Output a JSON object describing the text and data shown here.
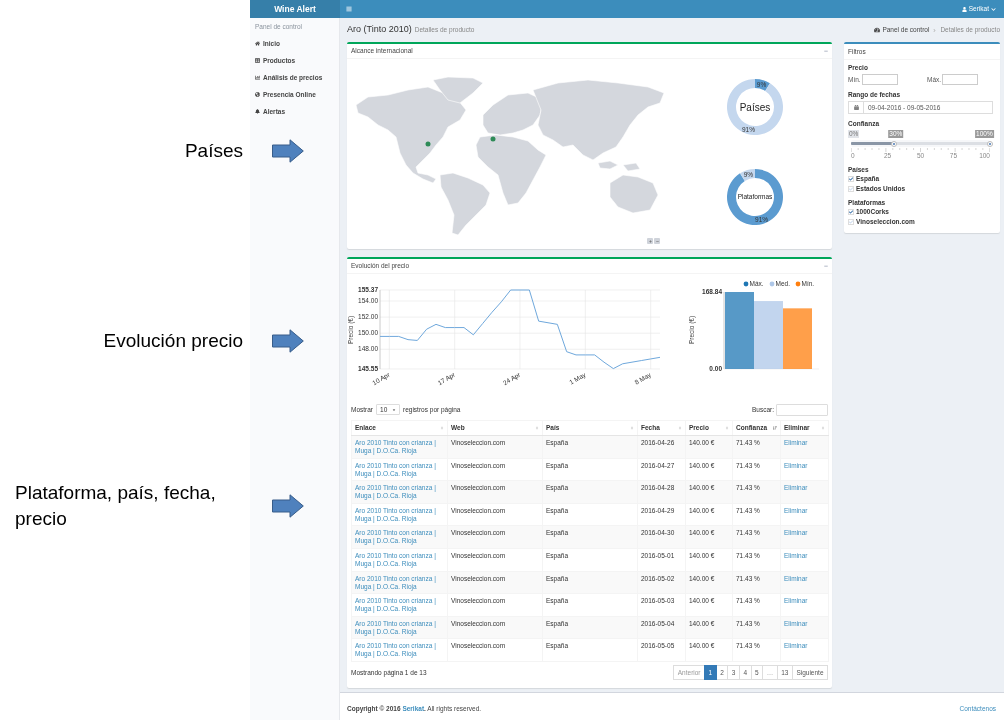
{
  "annotations": [
    {
      "text": "Países"
    },
    {
      "text": "Evolución precio"
    },
    {
      "text": "Plataforma, país, fecha, precio"
    }
  ],
  "topbar": {
    "brand": "Wine Alert",
    "user": "Serikat"
  },
  "sidebar": {
    "header": "Panel de control",
    "items": [
      {
        "label": "Inicio"
      },
      {
        "label": "Productos"
      },
      {
        "label": "Análisis de precios"
      },
      {
        "label": "Presencia Online"
      },
      {
        "label": "Alertas"
      }
    ]
  },
  "page_header": {
    "title": "Aro (Tinto 2010)",
    "subtitle": "Detalles de producto",
    "breadcrumb": [
      "Panel de control",
      "Detalles de producto"
    ]
  },
  "map_box": {
    "title": "Alcance internacional",
    "donuts": [
      {
        "chart_data": {
          "type": "donut",
          "title": "Países",
          "values": [
            9,
            91
          ],
          "colors": [
            "#5b9bd0",
            "#c4d7ee"
          ],
          "value_labels": [
            "9%",
            "91%"
          ]
        }
      },
      {
        "chart_data": {
          "type": "donut",
          "title": "Plataformas",
          "values": [
            91,
            9
          ],
          "colors": [
            "#5b9bd0",
            "#c4d7ee"
          ],
          "value_labels": [
            "91%",
            "9%"
          ]
        }
      }
    ]
  },
  "price_box": {
    "title": "Evolución del precio",
    "line_chart": {
      "chart_data": {
        "type": "line",
        "ylabel": "Precio (€)",
        "grid": true,
        "categories": [
          null,
          "10 Apr",
          null,
          null,
          null,
          null,
          null,
          null,
          "17 Apr",
          null,
          null,
          null,
          null,
          null,
          null,
          "24 Apr",
          null,
          null,
          null,
          null,
          null,
          null,
          "1 May",
          null,
          null,
          null,
          null,
          null,
          null,
          "8 May",
          null
        ],
        "series": [
          {
            "color": "#6fa8dc",
            "values": [
              149.6,
              149.6,
              149.6,
              149.2,
              149.1,
              150.5,
              151.1,
              150.7,
              150.7,
              150.7,
              149.8,
              151.2,
              152.6,
              153.9,
              155.37,
              155.37,
              155.37,
              151.5,
              151.3,
              151.1,
              147.7,
              147.3,
              147.3,
              147.3,
              146.4,
              145.6,
              146.2,
              146.4,
              146.6,
              146.8,
              147.0
            ]
          }
        ],
        "ylim": [
          145.55,
          155.37
        ],
        "yticks": [
          {
            "value": 145.55,
            "label": "145.55"
          },
          {
            "value": 148,
            "label": "148.00"
          },
          {
            "value": 150,
            "label": "150.00"
          },
          {
            "value": 152,
            "label": "152.00"
          },
          {
            "value": 154,
            "label": "154.00"
          },
          {
            "value": 155.37,
            "label": "155.37"
          }
        ]
      }
    },
    "bar_chart": {
      "chart_data": {
        "type": "bar",
        "ylabel": "Precio (€)",
        "series": [
          {
            "name": "Máx.",
            "color": "#1f77b4",
            "values": [
              168.84
            ]
          },
          {
            "name": "Med.",
            "color": "#aec7e8",
            "values": [
              149
            ]
          },
          {
            "name": "Mín.",
            "color": "#ff7f0e",
            "values": [
              133
            ]
          }
        ],
        "ylim": [
          0,
          168.84
        ],
        "yticks": [
          {
            "value": 0,
            "label": "0.00"
          },
          {
            "value": 168.84,
            "label": "168.84"
          }
        ]
      }
    },
    "table": {
      "length": {
        "label": "Mostrar",
        "value": "10",
        "suffix": "registros por página"
      },
      "search": {
        "label": "Buscar:"
      },
      "columns": [
        {
          "label": "Enlace",
          "sorted": false
        },
        {
          "label": "Web",
          "sorted": false
        },
        {
          "label": "País",
          "sorted": false
        },
        {
          "label": "Fecha",
          "sorted": false
        },
        {
          "label": "Precio",
          "sorted": false
        },
        {
          "label": "Confianza",
          "sorted": true
        },
        {
          "label": "Eliminar",
          "sorted": false
        }
      ],
      "rows": [
        {
          "enlace": "Aro 2010 Tinto con crianza | Muga | D.O.Ca. Rioja",
          "web": "Vinoseleccion.com",
          "pais": "España",
          "fecha": "2016-04-26",
          "precio": "140.00 €",
          "confianza": "71.43 %",
          "eliminar": "Eliminar"
        },
        {
          "enlace": "Aro 2010 Tinto con crianza | Muga | D.O.Ca. Rioja",
          "web": "Vinoseleccion.com",
          "pais": "España",
          "fecha": "2016-04-27",
          "precio": "140.00 €",
          "confianza": "71.43 %",
          "eliminar": "Eliminar"
        },
        {
          "enlace": "Aro 2010 Tinto con crianza | Muga | D.O.Ca. Rioja",
          "web": "Vinoseleccion.com",
          "pais": "España",
          "fecha": "2016-04-28",
          "precio": "140.00 €",
          "confianza": "71.43 %",
          "eliminar": "Eliminar"
        },
        {
          "enlace": "Aro 2010 Tinto con crianza | Muga | D.O.Ca. Rioja",
          "web": "Vinoseleccion.com",
          "pais": "España",
          "fecha": "2016-04-29",
          "precio": "140.00 €",
          "confianza": "71.43 %",
          "eliminar": "Eliminar"
        },
        {
          "enlace": "Aro 2010 Tinto con crianza | Muga | D.O.Ca. Rioja",
          "web": "Vinoseleccion.com",
          "pais": "España",
          "fecha": "2016-04-30",
          "precio": "140.00 €",
          "confianza": "71.43 %",
          "eliminar": "Eliminar"
        },
        {
          "enlace": "Aro 2010 Tinto con crianza | Muga | D.O.Ca. Rioja",
          "web": "Vinoseleccion.com",
          "pais": "España",
          "fecha": "2016-05-01",
          "precio": "140.00 €",
          "confianza": "71.43 %",
          "eliminar": "Eliminar"
        },
        {
          "enlace": "Aro 2010 Tinto con crianza | Muga | D.O.Ca. Rioja",
          "web": "Vinoseleccion.com",
          "pais": "España",
          "fecha": "2016-05-02",
          "precio": "140.00 €",
          "confianza": "71.43 %",
          "eliminar": "Eliminar"
        },
        {
          "enlace": "Aro 2010 Tinto con crianza | Muga | D.O.Ca. Rioja",
          "web": "Vinoseleccion.com",
          "pais": "España",
          "fecha": "2016-05-03",
          "precio": "140.00 €",
          "confianza": "71.43 %",
          "eliminar": "Eliminar"
        },
        {
          "enlace": "Aro 2010 Tinto con crianza | Muga | D.O.Ca. Rioja",
          "web": "Vinoseleccion.com",
          "pais": "España",
          "fecha": "2016-05-04",
          "precio": "140.00 €",
          "confianza": "71.43 %",
          "eliminar": "Eliminar"
        },
        {
          "enlace": "Aro 2010 Tinto con crianza | Muga | D.O.Ca. Rioja",
          "web": "Vinoseleccion.com",
          "pais": "España",
          "fecha": "2016-05-05",
          "precio": "140.00 €",
          "confianza": "71.43 %",
          "eliminar": "Eliminar"
        }
      ],
      "info": "Mostrando página 1 de 13",
      "pages": [
        {
          "label": "Anterior",
          "selected": false,
          "disabled": true
        },
        {
          "label": "1",
          "selected": true,
          "disabled": false
        },
        {
          "label": "2",
          "selected": false,
          "disabled": false
        },
        {
          "label": "3",
          "selected": false,
          "disabled": false
        },
        {
          "label": "4",
          "selected": false,
          "disabled": false
        },
        {
          "label": "5",
          "selected": false,
          "disabled": false
        },
        {
          "label": "…",
          "selected": false,
          "disabled": true
        },
        {
          "label": "13",
          "selected": false,
          "disabled": false
        },
        {
          "label": "Siguiente",
          "selected": false,
          "disabled": false
        }
      ]
    }
  },
  "filters": {
    "title": "Filtros",
    "price": {
      "label": "Precio",
      "min_label": "Mín.",
      "max_label": "Máx."
    },
    "date_range": {
      "label": "Rango de fechas",
      "value": "09-04-2016 - 09-05-2016"
    },
    "confidence": {
      "label": "Confianza",
      "min_label": "0%",
      "handles": [
        {
          "label": "30%",
          "level": 0.31
        },
        {
          "label": "100%",
          "level": 1
        }
      ],
      "ticks": [
        "0",
        "25",
        "50",
        "75",
        "100"
      ]
    },
    "groups": [
      {
        "label": "Países",
        "options": [
          {
            "label": "España",
            "checked": true
          },
          {
            "label": "Estados Unidos",
            "checked": false
          }
        ]
      },
      {
        "label": "Plataformas",
        "options": [
          {
            "label": "1000Corks",
            "checked": true
          },
          {
            "label": "Vinoseleccion.com",
            "checked": false
          }
        ]
      }
    ]
  },
  "footer": {
    "copyright": "Copyright © 2016",
    "company": "Serikat",
    "rest": "**.** All rights reserved.",
    "contact": "Contáctenos"
  }
}
